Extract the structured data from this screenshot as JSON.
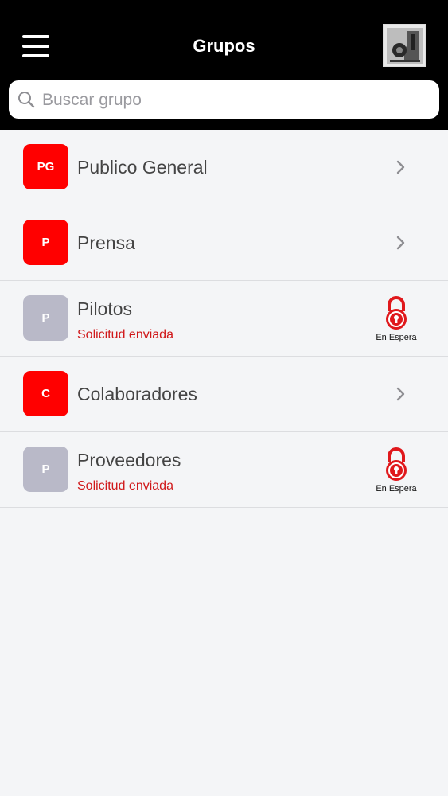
{
  "header": {
    "title": "Grupos",
    "menu_icon": "hamburger-menu-icon",
    "avatar_icon": "profile-photo"
  },
  "search": {
    "placeholder": "Buscar grupo",
    "value": ""
  },
  "colors": {
    "active_badge": "#ff0000",
    "pending_badge": "#b9b9c8",
    "status_text": "#d0181a",
    "header_bg": "#000000"
  },
  "groups": [
    {
      "initials": "PG",
      "name": "Publico General",
      "status": "",
      "state": "active",
      "action_icon": "chevron-right-icon"
    },
    {
      "initials": "P",
      "name": "Prensa",
      "status": "",
      "state": "active",
      "action_icon": "chevron-right-icon"
    },
    {
      "initials": "P",
      "name": "Pilotos",
      "status": "Solicitud enviada",
      "state": "pending",
      "action_icon": "lock-icon",
      "action_label": "En Espera"
    },
    {
      "initials": "C",
      "name": "Colaboradores",
      "status": "",
      "state": "active",
      "action_icon": "chevron-right-icon"
    },
    {
      "initials": "P",
      "name": "Proveedores",
      "status": "Solicitud enviada",
      "state": "pending",
      "action_icon": "lock-icon",
      "action_label": "En Espera"
    }
  ]
}
